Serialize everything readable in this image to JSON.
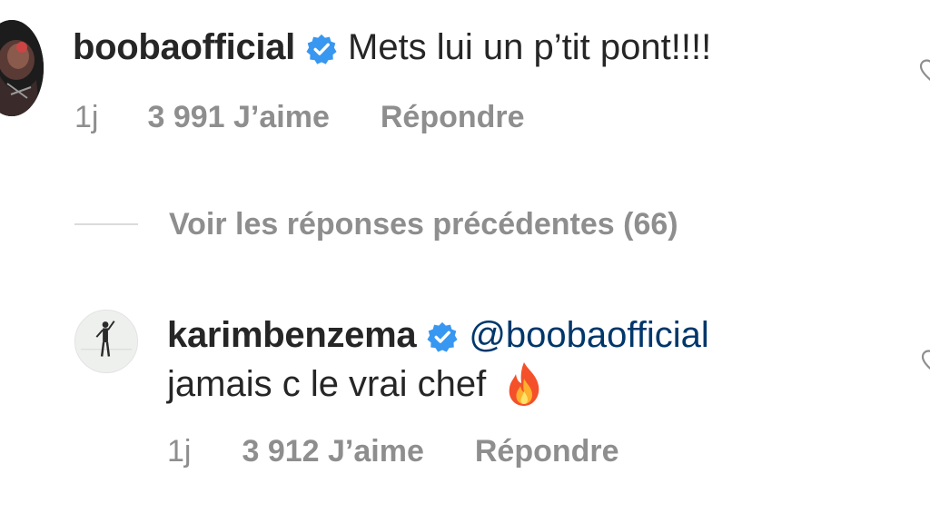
{
  "comments": [
    {
      "username": "boobaofficial",
      "verified": true,
      "text": "Mets lui un p’tit pont!!!!",
      "time": "1j",
      "likes": "3 991 J’aime",
      "reply_label": "Répondre"
    },
    {
      "username": "karimbenzema",
      "verified": true,
      "mention": "@boobaofficial",
      "text": "jamais c le vrai chef",
      "emoji": "fire-emoji",
      "time": "1j",
      "likes": "3 912 J’aime",
      "reply_label": "Répondre"
    }
  ],
  "view_replies_label": "Voir les réponses précédentes (66)",
  "icons": {
    "verified": "verified-badge-icon",
    "like": "heart-icon"
  },
  "colors": {
    "text_primary": "#262626",
    "text_secondary": "#8e8e8e",
    "mention": "#00376b",
    "verified_badge": "#3897f0",
    "divider": "#dbdbdb",
    "background": "#ffffff"
  }
}
